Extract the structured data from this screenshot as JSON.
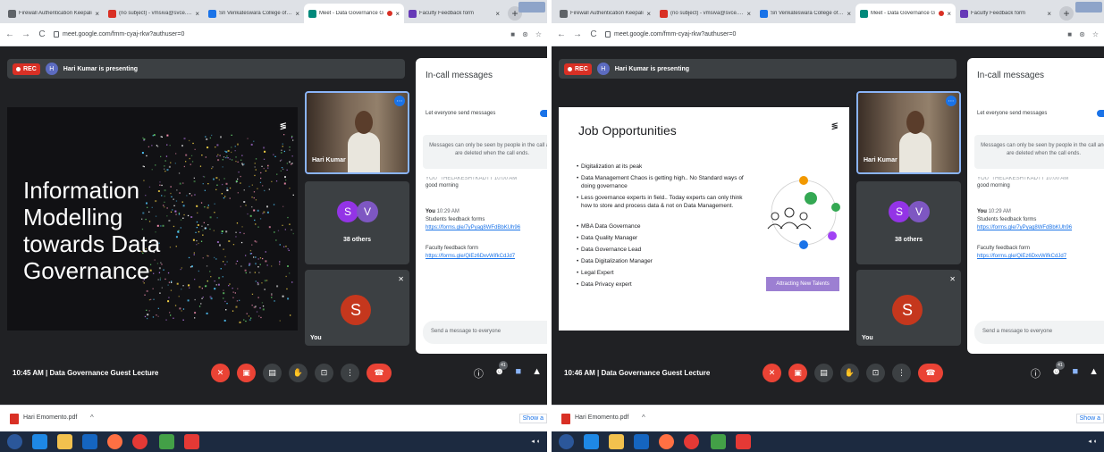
{
  "panels": [
    {
      "tabs": [
        {
          "title": "Firewall Authentication Keepali",
          "color": "#5f6368"
        },
        {
          "title": "(no subject) - vmsiva@svce.ac.i",
          "color": "#d93025"
        },
        {
          "title": "Sri Venkateswara College of Eng",
          "color": "#1a73e8"
        },
        {
          "title": "Meet - Data Governance G",
          "color": "#00897b",
          "active": true
        },
        {
          "title": "Faculty Feedback form",
          "color": "#673ab7"
        }
      ],
      "url": "meet.google.com/fmm-cyaj-rkw?authuser=0",
      "rec_label": "REC",
      "presenter_initial": "H",
      "presenting": "Hari Kumar is presenting",
      "slide_kind": "dark",
      "slide_title": "Information Modelling towards Data Governance",
      "slide_logo": "≶",
      "tile_name": "Hari Kumar",
      "initials": [
        "S",
        "V"
      ],
      "others": "38 others",
      "self_initial": "S",
      "self_label": "You",
      "chat": {
        "heading": "In-call messages",
        "allow": "Let everyone send messages",
        "note": "Messages can only be seen by people in the call and are deleted when the call ends.",
        "clipped": "YOU_T​HE​LAKE​SHT​KAD​TT  10:00 AM",
        "greeting": "good morning",
        "sender": "You",
        "time": "10:29 AM",
        "line1": "Students feedback forms",
        "link1": "https://forms.gle/7yPyag8WFdBbKUh96",
        "line2": "Faculty feedback form",
        "link2": "https://forms.gle/QiEz6DxvWifkCdJd7",
        "send_placeholder": "Send a message to everyone"
      },
      "clock": "10:45 AM  |  Data Governance Guest Lecture",
      "people_count": "41",
      "download": "Hari Emomento.pdf",
      "show_all": "Show a"
    },
    {
      "tabs": [
        {
          "title": "Firewall Authentication Keepali",
          "color": "#5f6368"
        },
        {
          "title": "(no subject) - vmsiva@svce.ac.i",
          "color": "#d93025"
        },
        {
          "title": "Sri Venkateswara College of Eng",
          "color": "#1a73e8"
        },
        {
          "title": "Meet - Data Governance G",
          "color": "#00897b",
          "active": true
        },
        {
          "title": "Faculty Feedback form",
          "color": "#673ab7"
        }
      ],
      "url": "meet.google.com/fmm-cyaj-rkw?authuser=0",
      "rec_label": "REC",
      "presenter_initial": "H",
      "presenting": "Hari Kumar is presenting",
      "slide_kind": "light",
      "slide_title": "Job Opportunities",
      "slide_logo": "≶",
      "bullets_a": [
        "Digitalization at its peak",
        "Data Management Chaos is getting high.. No Standard ways of doing governance",
        "Less governance experts in field.. Today experts can only think how to store and process data & not on Data Management."
      ],
      "bullets_b": [
        "MBA Data Governance",
        "Data Quality Manager",
        "Data Governance Lead",
        "Data Digitalization Manager",
        "Legal Expert",
        "Data Privacy expert"
      ],
      "attract_label": "Attracting New Talents",
      "tile_name": "Hari Kumar",
      "initials": [
        "S",
        "V"
      ],
      "others": "38 others",
      "self_initial": "S",
      "self_label": "You",
      "chat": {
        "heading": "In-call messages",
        "allow": "Let everyone send messages",
        "note": "Messages can only be seen by people in the call and are deleted when the call ends.",
        "clipped": "YOU_T​HE​LAKE​SHT​KAD​TT  10:00 AM",
        "greeting": "good morning",
        "sender": "You",
        "time": "10:29 AM",
        "line1": "Students feedback forms",
        "link1": "https://forms.gle/7yPyag8WFdBbKUh96",
        "line2": "Faculty feedback form",
        "link2": "https://forms.gle/QiEz6DxvWifkCdJd7",
        "send_placeholder": "Send a message to everyone"
      },
      "clock": "10:46 AM  |  Data Governance Guest Lecture",
      "people_count": "41",
      "download": "Hari Emomento.pdf",
      "show_all": "Show a"
    }
  ],
  "colors": {
    "accent": "#1a73e8",
    "danger": "#ea4335",
    "meet_bg": "#202124",
    "purple_label": "#9c7fd2"
  },
  "icons": [
    "back-icon",
    "forward-icon",
    "reload-icon",
    "lock-icon",
    "mic-off-icon",
    "camera-off-icon",
    "captions-icon",
    "raise-hand-icon",
    "present-icon",
    "more-icon",
    "end-call-icon",
    "info-icon",
    "people-icon",
    "chat-icon",
    "activities-icon"
  ]
}
